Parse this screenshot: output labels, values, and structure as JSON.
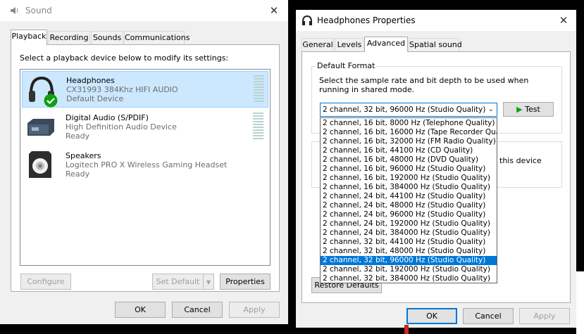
{
  "sound": {
    "title": "Sound",
    "close": "✕",
    "tabs": [
      "Playback",
      "Recording",
      "Sounds",
      "Communications"
    ],
    "instruction": "Select a playback device below to modify its settings:",
    "devices": [
      {
        "name": "Headphones",
        "detail": "CX31993 384Khz HIFI AUDIO",
        "status": "Default Device"
      },
      {
        "name": "Digital Audio (S/PDIF)",
        "detail": "High Definition Audio Device",
        "status": "Ready"
      },
      {
        "name": "Speakers",
        "detail": "Logitech PRO X Wireless Gaming Headset",
        "status": "Ready"
      }
    ],
    "buttons": {
      "configure": "Configure",
      "set_default": "Set Default",
      "properties": "Properties",
      "ok": "OK",
      "cancel": "Cancel",
      "apply": "Apply"
    }
  },
  "props": {
    "title": "Headphones Properties",
    "close": "✕",
    "tabs": [
      "General",
      "Levels",
      "Advanced",
      "Spatial sound"
    ],
    "default_format_label": "Default Format",
    "description": "Select the sample rate and bit depth to be used when running in shared mode.",
    "selected_format": "2 channel, 32 bit, 96000 Hz (Studio Quality)",
    "test_label": "Test",
    "obscured_text": "this device",
    "restore_label": "Restore Defaults",
    "format_options": [
      "2 channel, 16 bit, 8000 Hz (Telephone Quality)",
      "2 channel, 16 bit, 16000 Hz (Tape Recorder Quality)",
      "2 channel, 16 bit, 32000 Hz (FM Radio Quality)",
      "2 channel, 16 bit, 44100 Hz (CD Quality)",
      "2 channel, 16 bit, 48000 Hz (DVD Quality)",
      "2 channel, 16 bit, 96000 Hz (Studio Quality)",
      "2 channel, 16 bit, 192000 Hz (Studio Quality)",
      "2 channel, 16 bit, 384000 Hz (Studio Quality)",
      "2 channel, 24 bit, 44100 Hz (Studio Quality)",
      "2 channel, 24 bit, 48000 Hz (Studio Quality)",
      "2 channel, 24 bit, 96000 Hz (Studio Quality)",
      "2 channel, 24 bit, 192000 Hz (Studio Quality)",
      "2 channel, 24 bit, 384000 Hz (Studio Quality)",
      "2 channel, 32 bit, 44100 Hz (Studio Quality)",
      "2 channel, 32 bit, 48000 Hz (Studio Quality)",
      "2 channel, 32 bit, 96000 Hz (Studio Quality)",
      "2 channel, 32 bit, 192000 Hz (Studio Quality)",
      "2 channel, 32 bit, 384000 Hz (Studio Quality)"
    ],
    "selected_index": 15,
    "buttons": {
      "ok": "OK",
      "cancel": "Cancel",
      "apply": "Apply"
    }
  },
  "colors": {
    "accent": "#0078d7",
    "selection": "#cce8ff",
    "check": "#10a010"
  }
}
